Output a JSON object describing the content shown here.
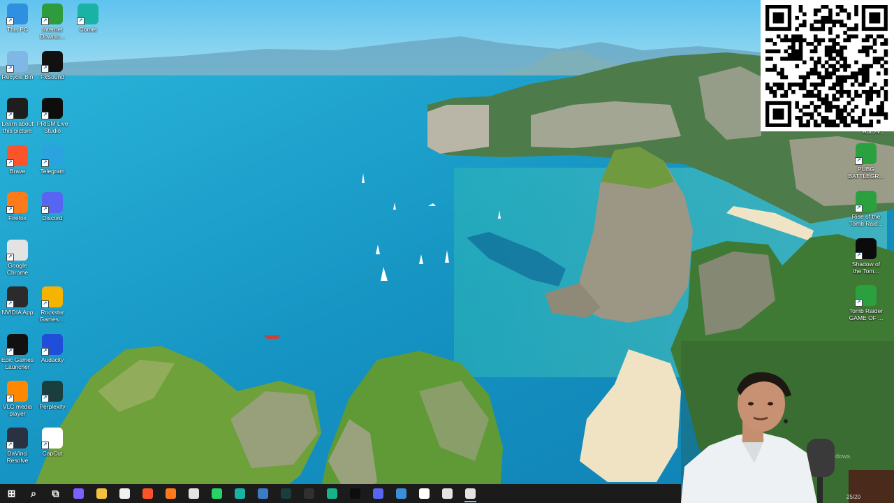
{
  "desktop": {
    "left_icons": [
      {
        "label": "This PC",
        "icon": "monitor-icon",
        "color": "#2f8fe0"
      },
      {
        "label": "Internet Downlo...",
        "icon": "idm-globe-icon",
        "color": "#2e9b3f"
      },
      {
        "label": "Comet",
        "icon": "comet-icon",
        "color": "#19b3a6"
      },
      {
        "label": "Recycle Bin",
        "icon": "recycle-bin-icon",
        "color": "#7fb7e6"
      },
      {
        "label": "FxSound",
        "icon": "fxsound-icon",
        "color": "#111111"
      },
      {
        "label": "Learn about this picture",
        "icon": "camera-icon",
        "color": "#1e1e1e"
      },
      {
        "label": "PRISM Live Studio",
        "icon": "prism-icon",
        "color": "#0d0d0d"
      },
      {
        "label": "Brave",
        "icon": "brave-lion-icon",
        "color": "#fb542b"
      },
      {
        "label": "Telegram",
        "icon": "telegram-icon",
        "color": "#2aa3df"
      },
      {
        "label": "Firefox",
        "icon": "firefox-icon",
        "color": "#ff7a1a"
      },
      {
        "label": "Discord",
        "icon": "discord-icon",
        "color": "#5865f2"
      },
      {
        "label": "Google Chrome",
        "icon": "chrome-icon",
        "color": "#e3e3e3"
      },
      {
        "label": "NVIDIA App",
        "icon": "nvidia-icon",
        "color": "#2b2b2b"
      },
      {
        "label": "Rockstar Games ...",
        "icon": "rockstar-icon",
        "color": "#f6b400"
      },
      {
        "label": "Epic Games Launcher",
        "icon": "epic-games-icon",
        "color": "#111111"
      },
      {
        "label": "Audacity",
        "icon": "audacity-icon",
        "color": "#1f4ed8"
      },
      {
        "label": "VLC media player",
        "icon": "vlc-cone-icon",
        "color": "#ff8800"
      },
      {
        "label": "Perplexity",
        "icon": "perplexity-icon",
        "color": "#1a3d3d"
      },
      {
        "label": "DaVinci Resolve",
        "icon": "davinci-icon",
        "color": "#2a3140"
      },
      {
        "label": "CapCut",
        "icon": "capcut-icon",
        "color": "#ffffff"
      }
    ],
    "right_icons": [
      {
        "label": "PUBG BATTLEGR...",
        "icon": "globe-icon",
        "color": "#2aa13e"
      },
      {
        "label": "Rise of the Tomb Raid...",
        "icon": "globe-icon",
        "color": "#2aa13e"
      },
      {
        "label": "Shadow of the Tom...",
        "icon": "shadow-tomb-raider-icon",
        "color": "#0b0b0b"
      },
      {
        "label": "Tomb Raider GAME OF ...",
        "icon": "globe-icon",
        "color": "#2aa13e"
      }
    ],
    "partial_label_top_right": "Auto-V...",
    "watermark": "dows."
  },
  "taskbar": {
    "items": [
      {
        "name": "start-button",
        "icon": "windows-logo-icon",
        "color": "#ffffff",
        "glyph": "⊞"
      },
      {
        "name": "search-button",
        "icon": "search-icon",
        "color": "#ffffff",
        "glyph": "⌕"
      },
      {
        "name": "task-view-button",
        "icon": "task-view-icon",
        "color": "#ffffff",
        "glyph": "⧉"
      },
      {
        "name": "copilot-button",
        "icon": "copilot-icon",
        "color": "#7b61ff",
        "glyph": ""
      },
      {
        "name": "file-explorer-button",
        "icon": "folder-icon",
        "color": "#f4c041",
        "glyph": ""
      },
      {
        "name": "store-button",
        "icon": "store-icon",
        "color": "#f0f0f0",
        "glyph": ""
      },
      {
        "name": "brave-taskbar-button",
        "icon": "brave-lion-icon",
        "color": "#fb542b",
        "glyph": ""
      },
      {
        "name": "firefox-taskbar-button",
        "icon": "firefox-icon",
        "color": "#ff7a1a",
        "glyph": ""
      },
      {
        "name": "chrome-taskbar-button",
        "icon": "chrome-icon",
        "color": "#e3e3e3",
        "glyph": ""
      },
      {
        "name": "whatsapp-button",
        "icon": "whatsapp-icon",
        "color": "#25d366",
        "glyph": ""
      },
      {
        "name": "comet-taskbar-button",
        "icon": "comet-icon",
        "color": "#19b3a6",
        "glyph": ""
      },
      {
        "name": "app-taskbar-button",
        "icon": "app-icon",
        "color": "#3c7cc4",
        "glyph": ""
      },
      {
        "name": "perplexity-taskbar-button",
        "icon": "perplexity-icon",
        "color": "#1a3d3d",
        "glyph": ""
      },
      {
        "name": "obs-button",
        "icon": "obs-icon",
        "color": "#303030",
        "glyph": ""
      },
      {
        "name": "feedback-button",
        "icon": "feedback-icon",
        "color": "#16b38b",
        "glyph": ""
      },
      {
        "name": "prism-taskbar-button",
        "icon": "prism-icon",
        "color": "#0d0d0d",
        "glyph": ""
      },
      {
        "name": "discord-taskbar-button",
        "icon": "discord-icon",
        "color": "#5865f2",
        "glyph": ""
      },
      {
        "name": "screen-tool-button",
        "icon": "screen-tool-icon",
        "color": "#3b8fd9",
        "glyph": ""
      },
      {
        "name": "capcut-taskbar-button",
        "icon": "capcut-icon",
        "color": "#ffffff",
        "glyph": ""
      },
      {
        "name": "chrome-profile-button",
        "icon": "chrome-icon",
        "color": "#e3e3e3",
        "glyph": ""
      },
      {
        "name": "chrome-active-button",
        "icon": "chrome-icon",
        "color": "#e3e3e3",
        "glyph": "",
        "active": true
      }
    ],
    "date_partial": "25/20"
  }
}
